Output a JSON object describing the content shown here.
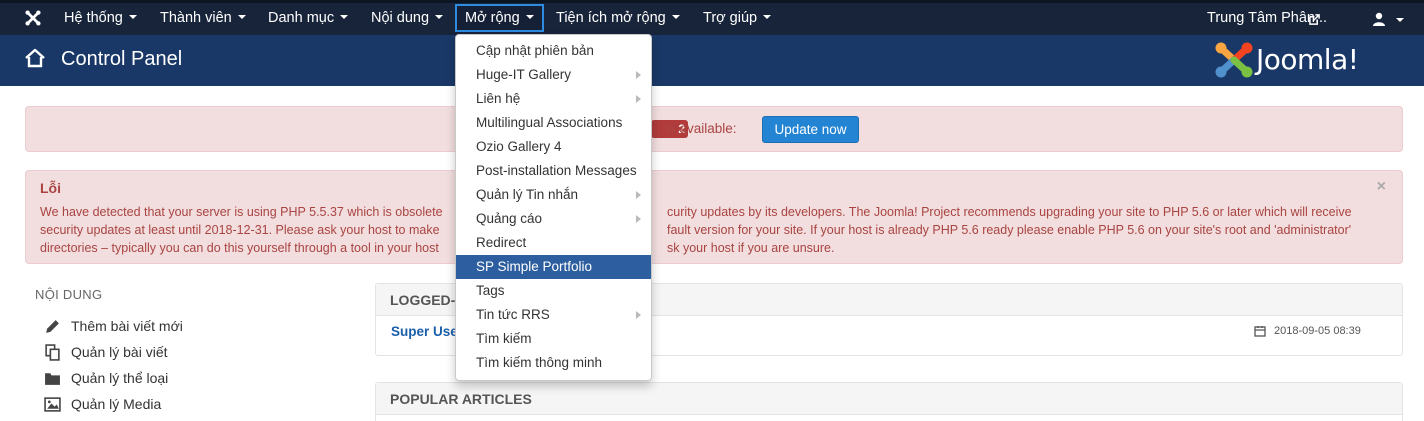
{
  "navbar": {
    "logo_icon": "joomla-icon",
    "items": [
      {
        "label": "Hệ thống"
      },
      {
        "label": "Thành viên"
      },
      {
        "label": "Danh mục"
      },
      {
        "label": "Nội dung"
      },
      {
        "label": "Mở rộng"
      },
      {
        "label": "Tiện ích mở rộng"
      },
      {
        "label": "Trợ giúp"
      }
    ],
    "site_link": "Trung Tâm Phân...",
    "user_icon": "user-icon"
  },
  "header": {
    "title": "Control Panel",
    "home_icon": "home-icon",
    "brand_text": "Joomla!"
  },
  "update_alert": {
    "badge": "2",
    "text": "is available:",
    "button": "Update now"
  },
  "error_alert": {
    "title": "Lỗi",
    "line1_a": "We have detected that your server is using PHP 5.5.37 which is obsolete",
    "line1_b": "curity updates by its developers. The Joomla! Project recommends upgrading your site to PHP 5.6 or later which will receive",
    "line2_a": "security updates at least until 2018-12-31. Please ask your host to make",
    "line2_b": "fault version for your site. If your host is already PHP 5.6 ready please enable PHP 5.6 on your site's root and 'administrator'",
    "line3_a": "directories – typically you can do this yourself through a tool in your host",
    "line3_b": "sk your host if you are unsure."
  },
  "sidebar": {
    "heading": "NỘI DUNG",
    "items": [
      {
        "label": "Thêm bài viết mới",
        "icon": "pencil-icon"
      },
      {
        "label": "Quản lý bài viết",
        "icon": "copy-icon"
      },
      {
        "label": "Quản lý thể loại",
        "icon": "folder-icon"
      },
      {
        "label": "Quản lý Media",
        "icon": "image-icon"
      }
    ]
  },
  "logged_in": {
    "heading": "LOGGED-I",
    "user": "Super Use",
    "date": "2018-09-05 08:39"
  },
  "popular": {
    "heading": "POPULAR ARTICLES"
  },
  "dropdown": {
    "items": [
      {
        "label": "Cập nhật phiên bản",
        "submenu": false
      },
      {
        "label": "Huge-IT Gallery",
        "submenu": true
      },
      {
        "label": "Liên hệ",
        "submenu": true
      },
      {
        "label": "Multilingual Associations",
        "submenu": false
      },
      {
        "label": "Ozio Gallery 4",
        "submenu": false
      },
      {
        "label": "Post-installation Messages",
        "submenu": false
      },
      {
        "label": "Quản lý Tin nhắn",
        "submenu": true
      },
      {
        "label": "Quảng cáo",
        "submenu": true
      },
      {
        "label": "Redirect",
        "submenu": false
      },
      {
        "label": "SP Simple Portfolio",
        "submenu": false
      },
      {
        "label": "Tags",
        "submenu": false
      },
      {
        "label": "Tin tức RRS",
        "submenu": true
      },
      {
        "label": "Tìm kiếm",
        "submenu": false
      },
      {
        "label": "Tìm kiếm thông minh",
        "submenu": false
      }
    ]
  },
  "colors": {
    "navbar": "#17243a",
    "header": "#1a3867",
    "highlight": "#2d5e9f",
    "alert_bg": "#f2dede",
    "alert_text": "#a94442",
    "button": "#2384d3"
  }
}
